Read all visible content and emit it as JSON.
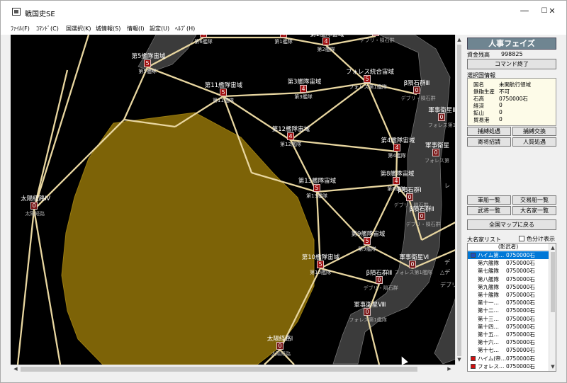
{
  "window": {
    "title": "戦国史SE",
    "minimize": "—",
    "maximize": "☐",
    "close": "✕"
  },
  "menu": [
    "ﾌｧｲﾙ(F)",
    "ｺﾏﾝﾄﾞ(C)",
    "国選択(K)",
    "城情報(S)",
    "情報(I)",
    "設定(U)",
    "ﾍﾙﾌﾟ(H)"
  ],
  "panel": {
    "phase": "人事フェイズ",
    "funds_label": "資金残高",
    "funds_value": "998825",
    "end_command": "コマンド終了",
    "info_title": "選択国情報",
    "info_rows": [
      {
        "label": "国名",
        "value": "未開航行領域"
      },
      {
        "label": "鉄砲生産",
        "value": "不可"
      },
      {
        "label": "石高",
        "value": "0750000石"
      },
      {
        "label": "経済",
        "value": "0"
      },
      {
        "label": "鉱山",
        "value": "0"
      },
      {
        "label": "貿易港",
        "value": "0"
      }
    ],
    "buttons_a": [
      "捕縛処遇",
      "捕縛交換",
      "寄将招請",
      "人質処遇"
    ],
    "buttons_b": [
      "軍船一覧",
      "交易船一覧",
      "武将一覧",
      "大名家一覧"
    ],
    "back_map": "全国マップに戻る",
    "list_title": "大名家リスト",
    "color_split": "色分け表示",
    "list_header": "(影武者)",
    "list_rows": [
      {
        "name": "ハイム第…",
        "value": "0750000石",
        "color": "#1e4fbf"
      },
      {
        "name": "第六艦隊",
        "value": "0750000石",
        "color": ""
      },
      {
        "name": "第七艦隊",
        "value": "0750000石",
        "color": ""
      },
      {
        "name": "第八艦隊",
        "value": "0750000石",
        "color": ""
      },
      {
        "name": "第九艦隊",
        "value": "0750000石",
        "color": ""
      },
      {
        "name": "第十艦隊",
        "value": "0750000石",
        "color": ""
      },
      {
        "name": "第十一…",
        "value": "0750000石",
        "color": ""
      },
      {
        "name": "第十二…",
        "value": "0750000石",
        "color": ""
      },
      {
        "name": "第十三…",
        "value": "0750000石",
        "color": ""
      },
      {
        "name": "第十四…",
        "value": "0750000石",
        "color": ""
      },
      {
        "name": "第十五…",
        "value": "0750000石",
        "color": ""
      },
      {
        "name": "第十六…",
        "value": "0750000石",
        "color": ""
      },
      {
        "name": "第十七…",
        "value": "0750000石",
        "color": ""
      },
      {
        "name": "ハイム(帝…",
        "value": "0750000石",
        "color": "#d01010"
      },
      {
        "name": "フォレス…",
        "value": "0750000石",
        "color": "#d01010"
      }
    ]
  },
  "map": {
    "nodes": [
      {
        "name": "第5艦隊宙域",
        "count": "5",
        "sub": "第5艦隊"
      },
      {
        "name": "",
        "count": "4",
        "sub": "第6艦隊"
      },
      {
        "name": "",
        "count": "4",
        "sub": "第1艦隊"
      },
      {
        "name": "第2艦隊宙域",
        "count": "4",
        "sub": "第2艦隊"
      },
      {
        "name": "デブリ・隕石群Ⅱ",
        "count": "0",
        "sub": "デブリ・隕石群"
      },
      {
        "name": "第11艦隊宙域",
        "count": "5",
        "sub": "第11艦隊"
      },
      {
        "name": "第3艦隊宙域",
        "count": "4",
        "sub": "第3艦隊"
      },
      {
        "name": "フォレス統合宙域",
        "count": "5",
        "sub": "フォレス第1艦隊"
      },
      {
        "name": "β隕石群Ⅲ",
        "count": "0",
        "sub": "デブリ・隕石群"
      },
      {
        "name": "軍事衛星Ⅱ",
        "count": "0",
        "sub": "フォレス第1"
      },
      {
        "name": "第12艦隊宙域",
        "count": "4",
        "sub": "第12艦隊"
      },
      {
        "name": "第4艦隊宙域",
        "count": "4",
        "sub": "第4艦隊"
      },
      {
        "name": "軍事衛星",
        "count": "0",
        "sub": "フォレス第"
      },
      {
        "name": "第8艦隊宙域",
        "count": "4",
        "sub": "第8艦隊"
      },
      {
        "name": "第13艦隊宙域",
        "count": "5",
        "sub": "第13艦隊"
      },
      {
        "name": "太陽経路Ⅳ",
        "count": "0",
        "sub": "太陽経路"
      },
      {
        "name": "β隕石群Ⅰ",
        "count": "0",
        "sub": "デブリ・隕石群"
      },
      {
        "name": "β隕石群Ⅱ",
        "count": "0",
        "sub": "デブリ・隕石群"
      },
      {
        "name": "第9艦隊宙域",
        "count": "5",
        "sub": "第9艦隊"
      },
      {
        "name": "軍事衛星Ⅵ",
        "count": "0",
        "sub": "フォレス第1艦隊"
      },
      {
        "name": "第10艦隊宙域",
        "count": "5",
        "sub": "第10艦隊"
      },
      {
        "name": "β隕石群Ⅲ",
        "count": "0",
        "sub": "デブリ・隕石群"
      },
      {
        "name": "軍事衛星Ⅷ",
        "count": "0",
        "sub": "フォレス第1艦隊"
      },
      {
        "name": "太陽経路Ⅰ",
        "count": "0",
        "sub": "太陽経路"
      }
    ],
    "fragments": [
      "レ",
      "デ",
      "△デ",
      "デブリ"
    ]
  }
}
